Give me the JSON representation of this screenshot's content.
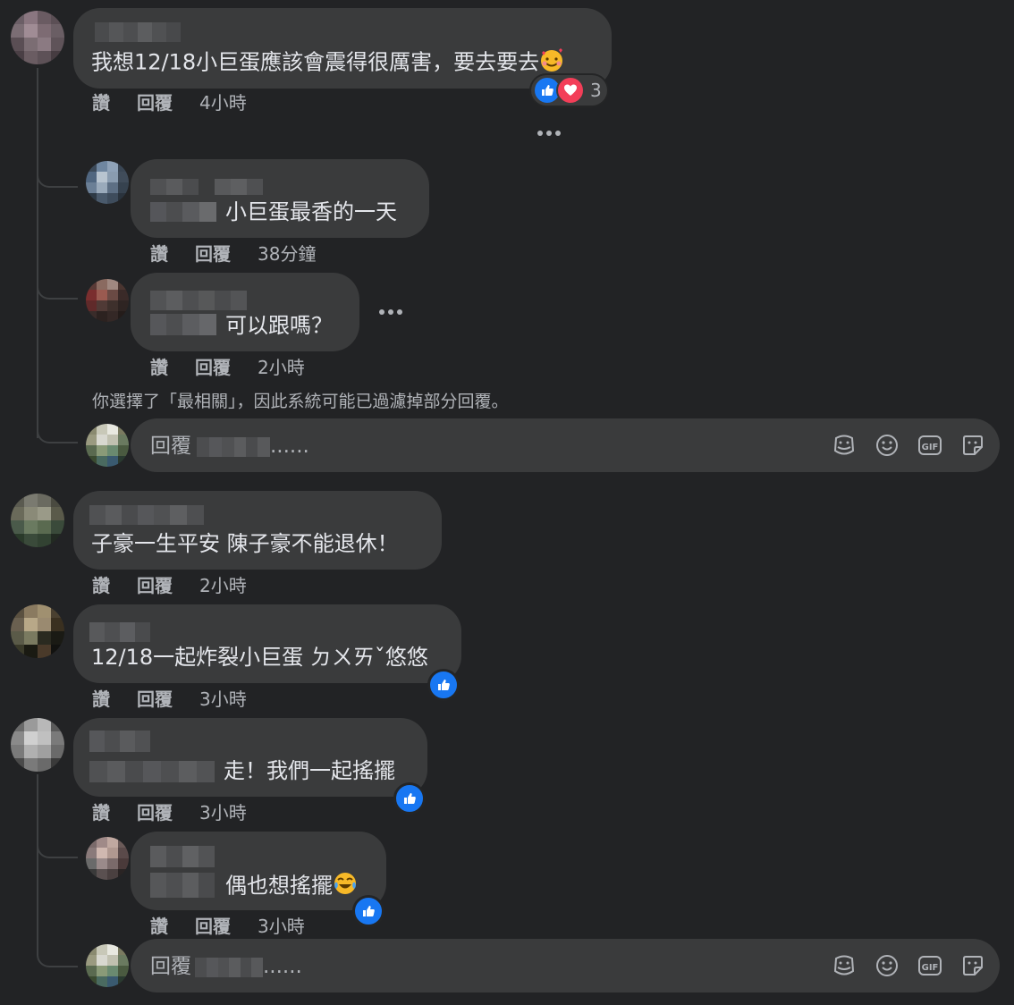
{
  "comments": [
    {
      "text": "我想12/18小巨蛋應該會震得很厲害，要去要去",
      "emoji": "smiling-face-with-hearts",
      "actions": {
        "like": "讚",
        "reply": "回覆",
        "time": "4小時"
      },
      "reactions": {
        "count": "3"
      }
    },
    {
      "text": "小巨蛋最香的一天",
      "actions": {
        "like": "讚",
        "reply": "回覆",
        "time": "38分鐘"
      }
    },
    {
      "text": "可以跟嗎？",
      "actions": {
        "like": "讚",
        "reply": "回覆",
        "time": "2小時"
      }
    },
    {
      "text": "子豪一生平安 陳子豪不能退休！",
      "actions": {
        "like": "讚",
        "reply": "回覆",
        "time": "2小時"
      }
    },
    {
      "text": "12/18一起炸裂小巨蛋 ㄉㄨㄞˇ悠悠",
      "actions": {
        "like": "讚",
        "reply": "回覆",
        "time": "3小時"
      }
    },
    {
      "text": "走！我們一起搖擺",
      "actions": {
        "like": "讚",
        "reply": "回覆",
        "time": "3小時"
      }
    },
    {
      "text": "偶也想搖擺",
      "emoji": "tears-of-joy",
      "actions": {
        "like": "讚",
        "reply": "回覆",
        "time": "3小時"
      }
    }
  ],
  "filter_notice": "你選擇了「最相關」，因此系統可能已過濾掉部分回覆。",
  "reply_box": {
    "prefix": "回覆",
    "suffix": "......"
  },
  "icons": [
    "sticker-icon",
    "emoji-icon",
    "gif-icon",
    "sticker-icon"
  ],
  "colors": {
    "background": "#222325",
    "bubble": "#3a3b3c",
    "text": "#e4e6eb",
    "secondary": "#b0b3b8",
    "like": "#1877f2",
    "love": "#f33e58"
  }
}
